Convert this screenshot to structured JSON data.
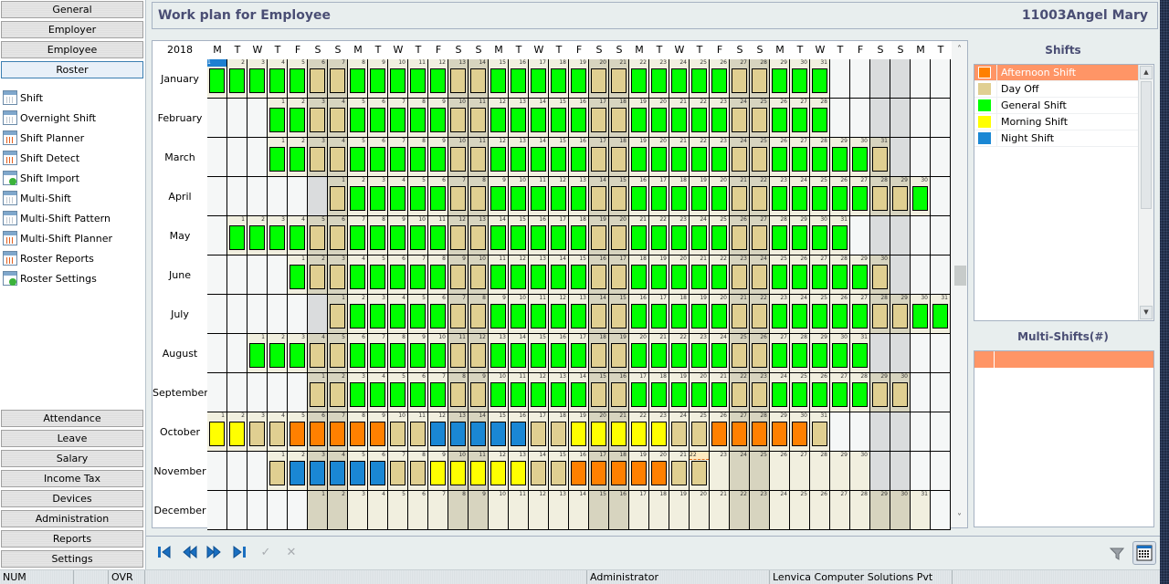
{
  "header": {
    "title": "Work plan for Employee",
    "employee": "11003Angel Mary"
  },
  "nav": {
    "top_buttons": [
      "General",
      "Employer",
      "Employee",
      "Roster"
    ],
    "active": "Roster",
    "roster_items": [
      {
        "label": "Shift",
        "icon": "shift-icon"
      },
      {
        "label": "Overnight Shift",
        "icon": "overnight-shift-icon"
      },
      {
        "label": "Shift Planner",
        "icon": "shift-planner-icon"
      },
      {
        "label": "Shift Detect",
        "icon": "shift-detect-icon"
      },
      {
        "label": "Shift Import",
        "icon": "shift-import-icon"
      },
      {
        "label": "Multi-Shift",
        "icon": "multi-shift-icon"
      },
      {
        "label": "Multi-Shift Pattern",
        "icon": "multi-shift-pattern-icon"
      },
      {
        "label": "Multi-Shift Planner",
        "icon": "multi-shift-planner-icon"
      },
      {
        "label": "Roster Reports",
        "icon": "roster-reports-icon"
      },
      {
        "label": "Roster Settings",
        "icon": "roster-settings-icon"
      }
    ],
    "bottom_buttons": [
      "Attendance",
      "Leave",
      "Salary",
      "Income Tax",
      "Devices",
      "Administration",
      "Reports",
      "Settings"
    ]
  },
  "calendar": {
    "year": "2018",
    "dow_headers": [
      "M",
      "T",
      "W",
      "T",
      "F",
      "S",
      "S",
      "M",
      "T",
      "W",
      "T",
      "F",
      "S",
      "S",
      "M",
      "T",
      "W",
      "T",
      "F",
      "S",
      "S",
      "M",
      "T",
      "W",
      "T",
      "F",
      "S",
      "S",
      "M",
      "T",
      "W",
      "T",
      "F",
      "S",
      "S",
      "M",
      "T"
    ],
    "selected_day": {
      "month": 0,
      "day": 1
    },
    "editing_day": {
      "month": 10,
      "day": 22
    },
    "months": [
      {
        "name": "January",
        "offset": 0,
        "days": 31,
        "pattern": "weekday"
      },
      {
        "name": "February",
        "offset": 3,
        "days": 28,
        "pattern": "weekday"
      },
      {
        "name": "March",
        "offset": 3,
        "days": 31,
        "pattern": "weekday"
      },
      {
        "name": "April",
        "offset": 6,
        "days": 30,
        "pattern": "weekday"
      },
      {
        "name": "May",
        "offset": 1,
        "days": 31,
        "pattern": "weekday"
      },
      {
        "name": "June",
        "offset": 4,
        "days": 30,
        "pattern": "weekday"
      },
      {
        "name": "July",
        "offset": 6,
        "days": 31,
        "pattern": "weekday"
      },
      {
        "name": "August",
        "offset": 2,
        "days": 31,
        "pattern": "weekday"
      },
      {
        "name": "September",
        "offset": 5,
        "days": 30,
        "pattern": "weekday"
      },
      {
        "name": "October",
        "offset": 0,
        "days": 31,
        "pattern": "explicit",
        "shifts": [
          "M",
          "M",
          "D",
          "D",
          "A",
          "A",
          "A",
          "A",
          "A",
          "D",
          "D",
          "N",
          "N",
          "N",
          "N",
          "N",
          "D",
          "D",
          "M",
          "M",
          "M",
          "M",
          "M",
          "D",
          "D",
          "A",
          "A",
          "A",
          "A",
          "A",
          "D"
        ]
      },
      {
        "name": "November",
        "offset": 3,
        "days": 30,
        "pattern": "explicit",
        "shifts": [
          "D",
          "N",
          "N",
          "N",
          "N",
          "N",
          "D",
          "D",
          "M",
          "M",
          "M",
          "M",
          "M",
          "D",
          "D",
          "A",
          "A",
          "A",
          "A",
          "A",
          "D",
          "D",
          "",
          "",
          "",
          "",
          "",
          "",
          "",
          ""
        ]
      },
      {
        "name": "December",
        "offset": 5,
        "days": 31,
        "pattern": "explicit",
        "shifts": []
      }
    ]
  },
  "shifts": {
    "title": "Shifts",
    "items": [
      {
        "code": "A",
        "name": "Afternoon Shift",
        "color": "#ff8000",
        "selected": true
      },
      {
        "code": "D",
        "name": "Day Off",
        "color": "#e0cf91",
        "selected": false
      },
      {
        "code": "G",
        "name": "General Shift",
        "color": "#00ff00",
        "selected": false
      },
      {
        "code": "M",
        "name": "Morning Shift",
        "color": "#ffff00",
        "selected": false
      },
      {
        "code": "N",
        "name": "Night Shift",
        "color": "#1a87d4",
        "selected": false
      }
    ]
  },
  "multi_shifts": {
    "title": "Multi-Shifts(#)"
  },
  "toolbar": {
    "first": "first-record",
    "prev": "previous-record",
    "next": "next-record",
    "last": "last-record",
    "confirm": "✓",
    "cancel": "✕"
  },
  "status": {
    "num": "NUM",
    "ovr": "OVR",
    "user": "Administrator",
    "company": "Lenvica Computer Solutions Pvt Ltd"
  }
}
